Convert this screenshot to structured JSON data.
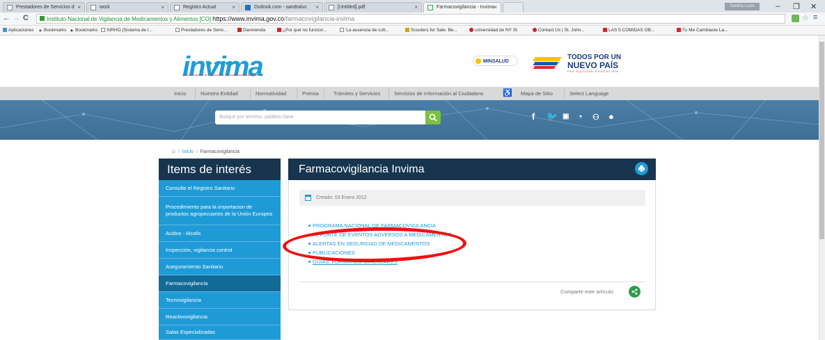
{
  "browser": {
    "tabs": [
      {
        "label": "Prestadores de Servicios d",
        "active": false
      },
      {
        "label": "work",
        "active": false
      },
      {
        "label": "Registro Actual",
        "active": false
      },
      {
        "label": "Outlook.com - sandraluc",
        "active": false
      },
      {
        "label": "[Untitled].pdf",
        "active": false
      },
      {
        "label": "Farmacovigilancia - Invima",
        "active": true
      }
    ],
    "user_chip": "Sandra Lucia",
    "url_site_label": "Instituto Nacional de Vigilancia de Medicamentos y Alimentos [CO]",
    "url_host": "https://www.invima.gov.co",
    "url_path": "/farmacovigilancia-invima",
    "bookmarks": [
      "Aplicaciones",
      "Bookmarks",
      "Bookmarks",
      "SIRHO (Sistema de I...",
      "Prestadores de Servi...",
      "Davivienda",
      "¿Por qué no funcion...",
      "'La ausencia de cult...",
      "Scooters for Sale. Be...",
      "universidad de NY St",
      "Contact Us | St. John...",
      "LAS 5 COMIDAS OB...",
      "Tu Me Cambiaste La..."
    ]
  },
  "header": {
    "logo_text": "invima",
    "logo_subtitle": "Instituto Nacional de Vigilancia de Medicamentos y Alimentos",
    "minsalud": "MINSALUD",
    "todos_line1": "TODOS POR UN",
    "todos_line2": "NUEVO PAÍS",
    "todos_sub": "PAZ  EQUIDAD  EDUCACIÓN"
  },
  "menu": [
    "Inicio",
    "Nuestra Entidad",
    "Normatividad",
    "Prensa",
    "Trámites y Servicios",
    "Servicios de Información al Ciudadano",
    "Mapa de Sitio",
    "Select Language"
  ],
  "search": {
    "placeholder": "Busque por término, palabra clave"
  },
  "breadcrumb": {
    "home_icon": "home-icon",
    "items": [
      "Inicio",
      "Farmacovigilancia"
    ]
  },
  "sidebar": {
    "title": "Items de interés",
    "items": [
      "Consulte el Registro Sanitario",
      "Procedimiento para la importacion de productos agropecuarios de la Unión Europea",
      "Acidos - Alcalis",
      "Inspección, vigilancia control",
      "Aseguramiento Sanitario",
      "Farmacovigilancia",
      "Tecnovigilancia",
      "Reactivovigilancia",
      "Salas Especializadas"
    ]
  },
  "article": {
    "title": "Farmacovigilancia Invima",
    "created": "Creado: 03 Enero 2012",
    "links": [
      "PROGRAMA NACIONAL DE FARMACOVIGILANCIA",
      "REPORTE DE EVENTOS ADVERSOS A MEDICAMENTOS",
      "ALERTAS EN SEGURIDAD DE MEDICAMENTOS",
      "PUBLICACIONES",
      "GUIAS, FORMATOS, CIRCULARES"
    ],
    "share_label": "Comparte este artículo"
  },
  "colors": {
    "accent": "#1e9bd7",
    "dark": "#17354f",
    "annotation": "#ee1111"
  }
}
